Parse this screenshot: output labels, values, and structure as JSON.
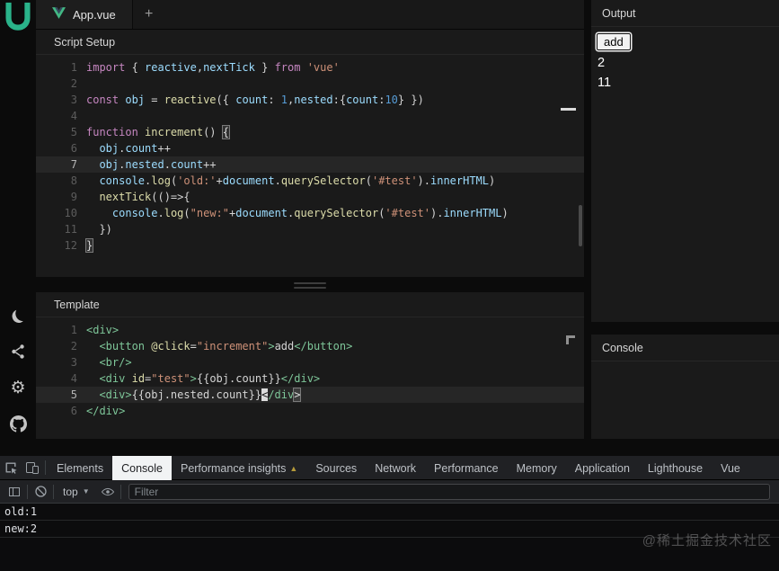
{
  "colors": {
    "accent_teal": "#2ab38a",
    "vue_green": "#42b883"
  },
  "sidebar": {
    "icons": [
      "app-logo",
      "moon-icon",
      "share-icon",
      "gear-icon",
      "github-icon"
    ]
  },
  "tabbar": {
    "file_tab": "App.vue",
    "new_tab_button": "+"
  },
  "script_editor": {
    "title": "Script Setup",
    "lines": [
      {
        "t": [
          [
            "k",
            "import"
          ],
          [
            "p",
            " { "
          ],
          [
            "v",
            "reactive"
          ],
          [
            "p",
            ","
          ],
          [
            "v",
            "nextTick"
          ],
          [
            "p",
            " } "
          ],
          [
            "k",
            "from"
          ],
          [
            "p",
            " "
          ],
          [
            "s",
            "'vue'"
          ]
        ]
      },
      {
        "t": []
      },
      {
        "t": [
          [
            "k",
            "const"
          ],
          [
            "p",
            " "
          ],
          [
            "v",
            "obj"
          ],
          [
            "p",
            " = "
          ],
          [
            "f",
            "reactive"
          ],
          [
            "p",
            "({ "
          ],
          [
            "v",
            "count"
          ],
          [
            "p",
            ": "
          ],
          [
            "n",
            "1"
          ],
          [
            "p",
            ","
          ],
          [
            "v",
            "nested"
          ],
          [
            "p",
            ":{"
          ],
          [
            "v",
            "count"
          ],
          [
            "p",
            ":"
          ],
          [
            "n",
            "10"
          ],
          [
            "p",
            "} })"
          ]
        ]
      },
      {
        "t": []
      },
      {
        "t": [
          [
            "k",
            "function"
          ],
          [
            "p",
            " "
          ],
          [
            "f",
            "increment"
          ],
          [
            "p",
            "() "
          ],
          [
            "b",
            "{"
          ]
        ]
      },
      {
        "t": [
          [
            "p",
            "  "
          ],
          [
            "v",
            "obj"
          ],
          [
            "p",
            "."
          ],
          [
            "v",
            "count"
          ],
          [
            "p",
            "++"
          ]
        ]
      },
      {
        "active": true,
        "t": [
          [
            "p",
            "  "
          ],
          [
            "v",
            "obj"
          ],
          [
            "p",
            "."
          ],
          [
            "v",
            "nested"
          ],
          [
            "p",
            "."
          ],
          [
            "v",
            "count"
          ],
          [
            "p",
            "++"
          ]
        ]
      },
      {
        "t": [
          [
            "p",
            "  "
          ],
          [
            "v",
            "console"
          ],
          [
            "p",
            "."
          ],
          [
            "f",
            "log"
          ],
          [
            "p",
            "("
          ],
          [
            "s",
            "'old:'"
          ],
          [
            "p",
            "+"
          ],
          [
            "v",
            "document"
          ],
          [
            "p",
            "."
          ],
          [
            "f",
            "querySelector"
          ],
          [
            "p",
            "("
          ],
          [
            "s",
            "'#test'"
          ],
          [
            "p",
            ")."
          ],
          [
            "v",
            "innerHTML"
          ],
          [
            "p",
            ")"
          ]
        ]
      },
      {
        "t": [
          [
            "p",
            "  "
          ],
          [
            "f",
            "nextTick"
          ],
          [
            "p",
            "(()=>{"
          ]
        ]
      },
      {
        "t": [
          [
            "p",
            "    "
          ],
          [
            "v",
            "console"
          ],
          [
            "p",
            "."
          ],
          [
            "f",
            "log"
          ],
          [
            "p",
            "("
          ],
          [
            "s",
            "\"new:\""
          ],
          [
            "p",
            "+"
          ],
          [
            "v",
            "document"
          ],
          [
            "p",
            "."
          ],
          [
            "f",
            "querySelector"
          ],
          [
            "p",
            "("
          ],
          [
            "s",
            "'#test'"
          ],
          [
            "p",
            ")."
          ],
          [
            "v",
            "innerHTML"
          ],
          [
            "p",
            ")"
          ]
        ]
      },
      {
        "t": [
          [
            "p",
            "  })"
          ]
        ]
      },
      {
        "t": [
          [
            "b",
            "}"
          ]
        ]
      }
    ]
  },
  "template_editor": {
    "title": "Template",
    "lines": [
      {
        "t": [
          [
            "t",
            "<div>"
          ]
        ]
      },
      {
        "t": [
          [
            "p",
            "  "
          ],
          [
            "t",
            "<button"
          ],
          [
            "p",
            " "
          ],
          [
            "a",
            "@click"
          ],
          [
            "p",
            "="
          ],
          [
            "s",
            "\"increment\""
          ],
          [
            "t",
            ">"
          ],
          [
            "p",
            "add"
          ],
          [
            "t",
            "</button>"
          ]
        ]
      },
      {
        "t": [
          [
            "p",
            "  "
          ],
          [
            "t",
            "<br/>"
          ]
        ]
      },
      {
        "t": [
          [
            "p",
            "  "
          ],
          [
            "t",
            "<div"
          ],
          [
            "p",
            " "
          ],
          [
            "a",
            "id"
          ],
          [
            "p",
            "="
          ],
          [
            "s",
            "\"test\""
          ],
          [
            "t",
            ">"
          ],
          [
            "p",
            "{{obj.count}}"
          ],
          [
            "t",
            "</div>"
          ]
        ]
      },
      {
        "active": true,
        "t": [
          [
            "p",
            "  "
          ],
          [
            "t",
            "<div>"
          ],
          [
            "p",
            "{{obj.nested.count}}"
          ],
          [
            "c",
            "<"
          ],
          [
            "t",
            "/div"
          ],
          [
            "b",
            ">"
          ]
        ]
      },
      {
        "t": [
          [
            "t",
            "</div>"
          ]
        ]
      }
    ]
  },
  "output_panel": {
    "title": "Output",
    "button_label": "add",
    "values": [
      "2",
      "11"
    ]
  },
  "console_panel": {
    "title": "Console"
  },
  "devtools": {
    "tabs": [
      {
        "label": "Elements"
      },
      {
        "label": "Console",
        "active": true
      },
      {
        "label": "Performance insights",
        "badge": "▲"
      },
      {
        "label": "Sources"
      },
      {
        "label": "Network"
      },
      {
        "label": "Performance"
      },
      {
        "label": "Memory"
      },
      {
        "label": "Application"
      },
      {
        "label": "Lighthouse"
      },
      {
        "label": "Vue"
      }
    ],
    "toolbar": {
      "context_selector": "top",
      "filter_placeholder": "Filter"
    },
    "messages": [
      "old:1",
      "new:2"
    ]
  },
  "watermark": "@稀土掘金技术社区"
}
